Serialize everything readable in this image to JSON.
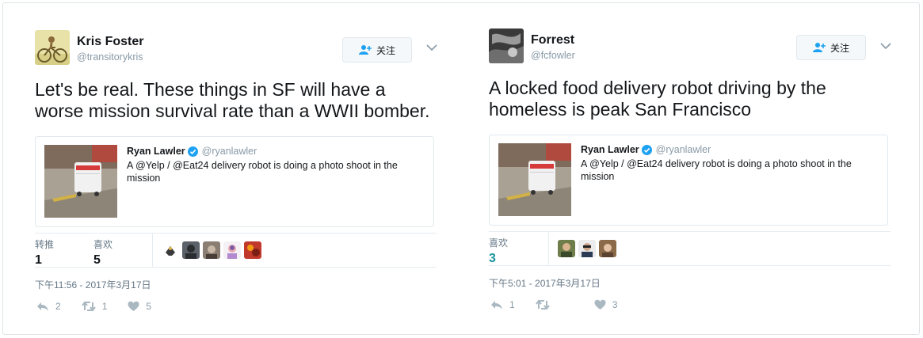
{
  "tweets": [
    {
      "name": "Kris Foster",
      "handle": "@transitorykris",
      "follow_label": "关注",
      "text": "Let's be real. These things in SF will have a worse mission survival rate than a WWII bomber.",
      "quote": {
        "name": "Ryan Lawler",
        "handle": "@ryanlawler",
        "text": "A @Yelp / @Eat24 delivery robot is doing a photo shoot in the mission"
      },
      "stats": [
        {
          "label": "转推",
          "value": "1"
        },
        {
          "label": "喜欢",
          "value": "5"
        }
      ],
      "timestamp": "下午11:56 - 2017年3月17日",
      "actions": {
        "reply": "2",
        "retweet": "1",
        "like": "5"
      }
    },
    {
      "name": "Forrest",
      "handle": "@fcfowler",
      "follow_label": "关注",
      "text": "A locked food delivery robot driving by the homeless is peak San Francisco",
      "quote": {
        "name": "Ryan Lawler",
        "handle": "@ryanlawler",
        "text": "A @Yelp / @Eat24 delivery robot is doing a photo shoot in the mission"
      },
      "stats": [
        {
          "label": "喜欢",
          "value": "3"
        }
      ],
      "timestamp": "下午5:01 - 2017年3月17日",
      "actions": {
        "reply": "1",
        "retweet": "",
        "like": "3"
      }
    }
  ],
  "colors": {
    "verified": "#1da1f2",
    "like_count_accent": "#1b95a0",
    "muted": "#8899a6"
  },
  "icons": [
    "add-user-icon",
    "chevron-down-icon",
    "verified-badge-icon",
    "reply-icon",
    "retweet-icon",
    "heart-icon"
  ]
}
